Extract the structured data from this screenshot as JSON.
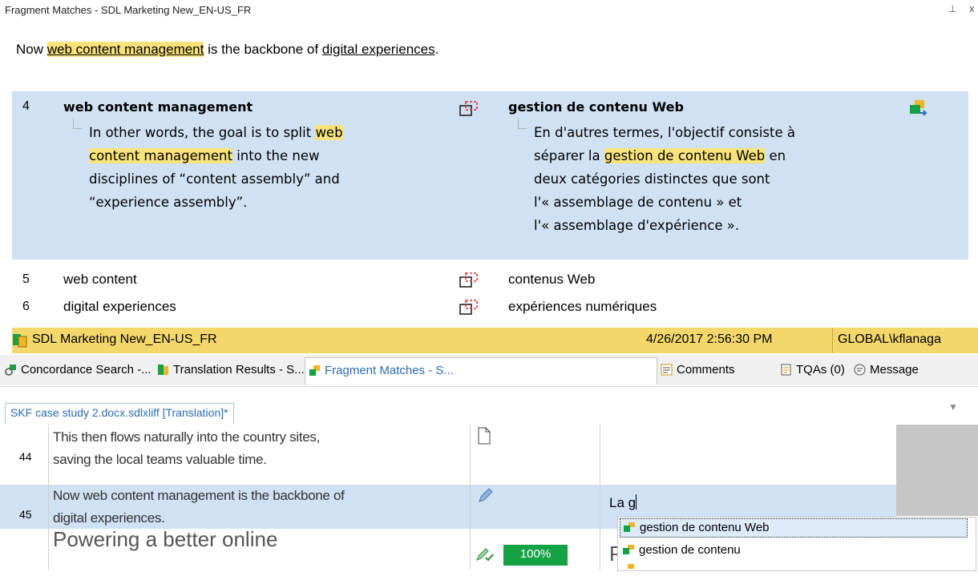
{
  "panel": {
    "title": "Fragment Matches - SDL Marketing New_EN-US_FR",
    "pin_icon": "pin-icon",
    "close_icon": "close-icon"
  },
  "source": {
    "prefix": "Now ",
    "term1": "web content management",
    "middle": " is the backbone of ",
    "term2": "digital experiences",
    "suffix": "."
  },
  "matches": [
    {
      "number": "4",
      "source_term": "web content management",
      "target_term": "gestion de contenu Web",
      "source_context": {
        "l1_pre": "In other words, the goal is to split ",
        "l1_hl": "web",
        "l2_hl": "content management",
        "l2_post": " into the new",
        "l3": "disciplines of “content assembly” and",
        "l4": "“experience assembly”."
      },
      "target_context": {
        "l1": "En d'autres termes, l'objectif consiste à",
        "l2_pre": "séparer la ",
        "l2_hl": "gestion de contenu Web",
        "l2_post": " en",
        "l3": "deux catégories distinctes que sont",
        "l4": "l'« assemblage de contenu » et",
        "l5": "l'« assemblage d'expérience »."
      }
    },
    {
      "number": "5",
      "source_term": "web content",
      "target_term": "contenus Web"
    },
    {
      "number": "6",
      "source_term": "digital experiences",
      "target_term": "expériences numériques"
    }
  ],
  "status_bar": {
    "tm_name": "SDL Marketing New_EN-US_FR",
    "date": "4/26/2017 2:56:30 PM",
    "user": "GLOBAL\\kflanaga"
  },
  "tabs": [
    {
      "label": "Concordance Search -...",
      "icon": "concordance-icon"
    },
    {
      "label": "Translation Results - S...",
      "icon": "translation-results-icon"
    },
    {
      "label": "Fragment Matches - S...",
      "icon": "fragment-matches-icon"
    },
    {
      "label": "Comments",
      "icon": "comments-icon"
    },
    {
      "label": "TQAs (0)",
      "icon": "tqa-icon"
    },
    {
      "label": "Message",
      "icon": "message-icon"
    }
  ],
  "document_tab": {
    "label": "SKF case study 2.docx.sdlxliff [Translation]*"
  },
  "segments": [
    {
      "number": "44",
      "source_l1": "This then flows naturally into the country sites,",
      "source_l2": "saving the local teams valuable time.",
      "target": ""
    },
    {
      "number": "45",
      "source_l1": "Now web content management is the backbone of",
      "source_l2": "digital experiences.",
      "target": "La g"
    },
    {
      "number": "",
      "source_l1": "Powering a better online",
      "match_badge": "100%",
      "target": "P"
    }
  ],
  "autosuggest": [
    "gestion de contenu Web",
    "gestion de contenu"
  ],
  "colors": {
    "highlight": "#f8e27a",
    "selected_row": "#cfe1f3",
    "status_bar": "#f4d76b",
    "match_badge": "#15a244"
  }
}
